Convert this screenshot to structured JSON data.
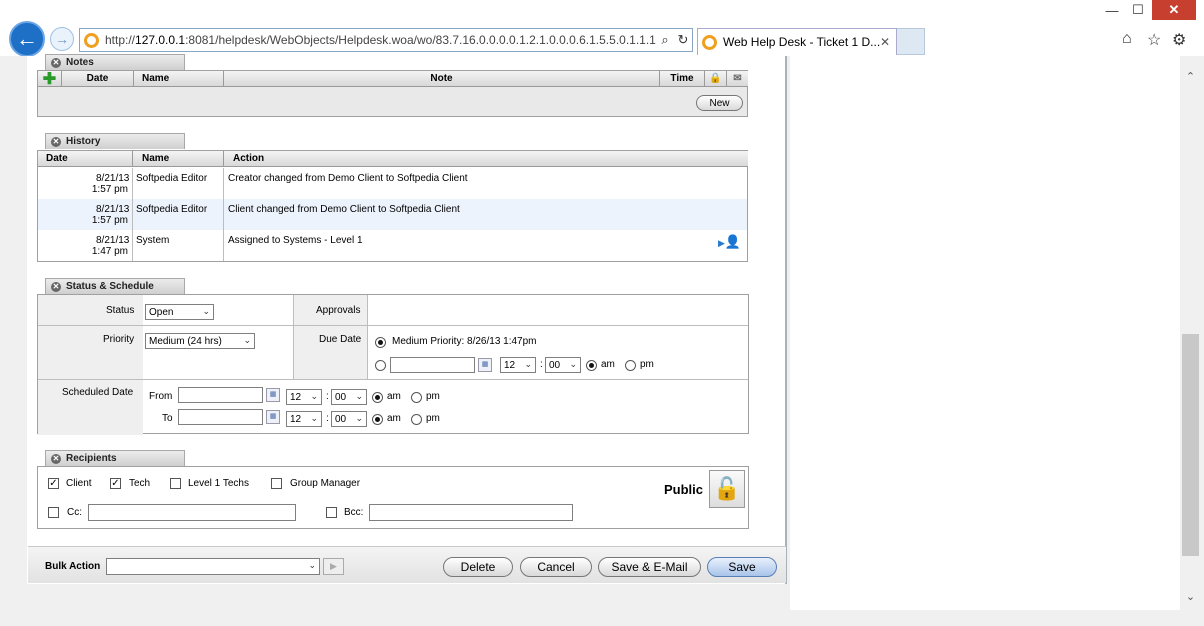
{
  "browser": {
    "address": {
      "prefix": "http://",
      "host": "127.0.0.1",
      "path": ":8081/helpdesk/WebObjects/Helpdesk.woa/wo/83.7.16.0.0.0.0.1.2.1.0.0.0.6.1.5.5.0.1.1.1."
    },
    "tab_title": "Web Help Desk - Ticket 1 D...",
    "icons": {
      "back": "←",
      "forward": "→",
      "search": "⌕",
      "refresh": "↻",
      "tab_close": "✕",
      "home": "⌂",
      "star": "☆",
      "gear": "⚙",
      "minimize": "—",
      "maximize": "☐",
      "close": "✕",
      "scroll_up": "⌃",
      "scroll_down": "⌄"
    }
  },
  "notes": {
    "header": "Notes",
    "columns": {
      "date": "Date",
      "name": "Name",
      "note": "Note",
      "time": "Time"
    },
    "new_button": "New"
  },
  "history": {
    "header": "History",
    "columns": {
      "date": "Date",
      "name": "Name",
      "action": "Action"
    },
    "rows": [
      {
        "date": "8/21/13",
        "time": "1:57 pm",
        "name": "Softpedia Editor",
        "action": "Creator changed from Demo Client to Softpedia Client"
      },
      {
        "date": "8/21/13",
        "time": "1:57 pm",
        "name": "Softpedia Editor",
        "action": "Client changed from Demo Client to Softpedia Client"
      },
      {
        "date": "8/21/13",
        "time": "1:47 pm",
        "name": "System",
        "action": "Assigned to Systems - Level 1"
      }
    ]
  },
  "status": {
    "header": "Status & Schedule",
    "status_label": "Status",
    "status_value": "Open",
    "approvals_label": "Approvals",
    "priority_label": "Priority",
    "priority_value": "Medium (24 hrs)",
    "due_label": "Due Date",
    "due_priority_text": "Medium Priority:  8/26/13   1:47pm",
    "due_hour": "12",
    "due_min": "00",
    "am": "am",
    "pm": "pm",
    "sched_label": "Scheduled Date",
    "from_label": "From",
    "to_label": "To",
    "from_hour": "12",
    "from_min": "00",
    "to_hour": "12",
    "to_min": "00",
    "colon": ":"
  },
  "recipients": {
    "header": "Recipients",
    "client": "Client",
    "tech": "Tech",
    "level1": "Level 1 Techs",
    "group_manager": "Group Manager",
    "cc": "Cc:",
    "bcc": "Bcc:",
    "public": "Public"
  },
  "footer": {
    "bulk_action": "Bulk Action",
    "delete": "Delete",
    "cancel": "Cancel",
    "save_email": "Save & E-Mail",
    "save": "Save"
  },
  "colors": {
    "accent": "#1e6fc6",
    "row_alt": "#edf3fc"
  }
}
